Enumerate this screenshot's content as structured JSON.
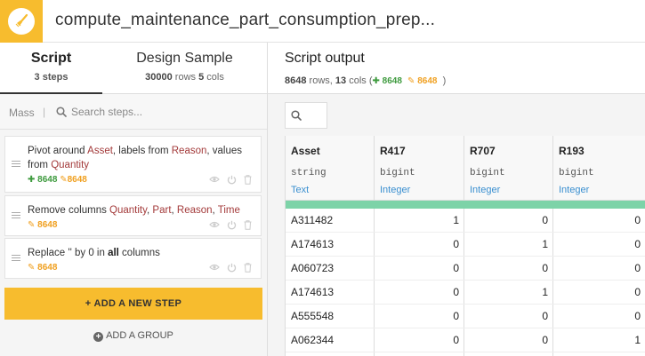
{
  "header": {
    "title": "compute_maintenance_part_consumption_prep...",
    "app_icon": "broom-icon",
    "accent": "#f7bc2e"
  },
  "tabs": [
    {
      "title": "Script",
      "sub_count": "3",
      "sub_text": " steps"
    },
    {
      "title": "Design Sample",
      "rows": "30000",
      "rows_label": " rows ",
      "cols": "5",
      "cols_label": " cols"
    }
  ],
  "search": {
    "mass_label": "Mass",
    "separator": "|",
    "placeholder": "Search steps..."
  },
  "steps": [
    {
      "parts": [
        "Pivot",
        " around ",
        "Asset",
        ", labels from ",
        "Reason",
        ", values from ",
        "Quantity"
      ],
      "badge_green": "8648",
      "badge_orange": "8648"
    },
    {
      "parts": [
        "Remove",
        " columns ",
        "Quantity",
        ", ",
        "Part",
        ", ",
        "Reason",
        ", ",
        "Time"
      ],
      "badge_orange": "8648"
    },
    {
      "parts": [
        "Replace",
        " '' by 0 in ",
        "all",
        " columns"
      ],
      "badge_orange": "8648"
    }
  ],
  "add_step_label": "+ ADD A NEW STEP",
  "add_group_label": "ADD A GROUP",
  "output": {
    "title": "Script output",
    "rows": "8648",
    "rows_label": " rows, ",
    "cols": "13",
    "cols_label": " cols  (",
    "badge_green": "8648",
    "badge_orange": "8648",
    "close_paren": ")"
  },
  "table": {
    "columns": [
      {
        "name": "Asset",
        "type": "string",
        "meaning": "Text"
      },
      {
        "name": "R417",
        "type": "bigint",
        "meaning": "Integer"
      },
      {
        "name": "R707",
        "type": "bigint",
        "meaning": "Integer"
      },
      {
        "name": "R193",
        "type": "bigint",
        "meaning": "Integer"
      }
    ],
    "rows": [
      [
        "A311482",
        "1",
        "0",
        "0"
      ],
      [
        "A174613",
        "0",
        "1",
        "0"
      ],
      [
        "A060723",
        "0",
        "0",
        "0"
      ],
      [
        "A174613",
        "0",
        "1",
        "0"
      ],
      [
        "A555548",
        "0",
        "0",
        "0"
      ],
      [
        "A062344",
        "0",
        "0",
        "1"
      ]
    ]
  },
  "colors": {
    "green_badge": "#3d9a3d",
    "orange_badge": "#f0a020",
    "highlight": "#a33a3a",
    "meaning": "#3a8fd0",
    "validity_bar": "#7dd3a8"
  }
}
